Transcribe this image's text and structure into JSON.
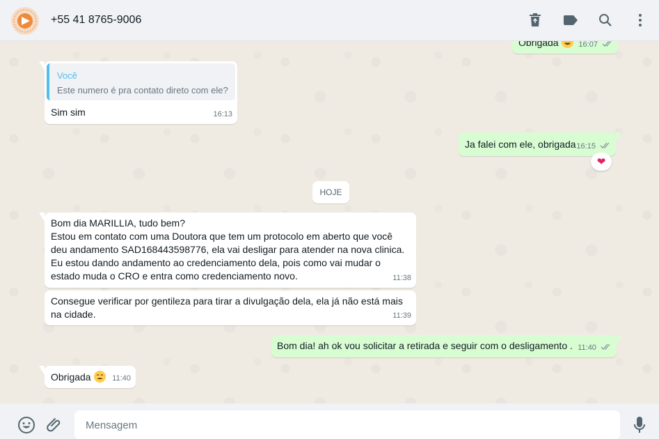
{
  "header": {
    "contact_name": "+55 41 8765-9006",
    "icons": [
      "delete-icon",
      "label-icon",
      "search-icon",
      "menu-icon"
    ]
  },
  "chat": {
    "top_partial": {
      "text": "Obrigada",
      "emoji": "grinning-face",
      "time": "16:07"
    },
    "reply_message": {
      "quote_author": "Você",
      "quote_text": "Este numero é pra contato direto com ele?",
      "text": "Sim sim",
      "time": "16:13"
    },
    "out_message_1": {
      "text": "Ja falei com ele, obrigada",
      "time": "16:15",
      "reaction": "❤"
    },
    "day_divider": "HOJE",
    "in_message_1": {
      "lines": [
        "Bom dia MARILLIA, tudo bem?",
        "Estou em contato com uma Doutora que tem um protocolo em aberto que você",
        "deu andamento SAD168443598776, ela vai desligar para atender na nova clinica.",
        "Eu estou dando andamento ao credenciamento dela, pois como vai mudar o",
        "estado muda o CRO e entra como credenciamento novo."
      ],
      "time": "11:38"
    },
    "in_message_2": {
      "lines": [
        "Consegue verificar por gentileza para tirar a divulgação dela, ela já não está mais",
        "na cidade."
      ],
      "time": "11:39"
    },
    "out_message_2": {
      "text": "Bom dia! ah ok vou solicitar a retirada e seguir com o desligamento .",
      "time": "11:40"
    },
    "in_message_3": {
      "text": "Obrigada",
      "emoji": "grinning-face",
      "time": "11:40"
    }
  },
  "footer": {
    "placeholder": "Mensagem",
    "icons": [
      "emoji-icon",
      "attach-icon",
      "microphone-icon"
    ]
  },
  "colors": {
    "incoming_bubble": "#ffffff",
    "outgoing_bubble": "#d9fdd3",
    "quote_accent": "#53bdeb",
    "read_ticks": "#8696a0",
    "reaction_heart": "#e0245e"
  }
}
